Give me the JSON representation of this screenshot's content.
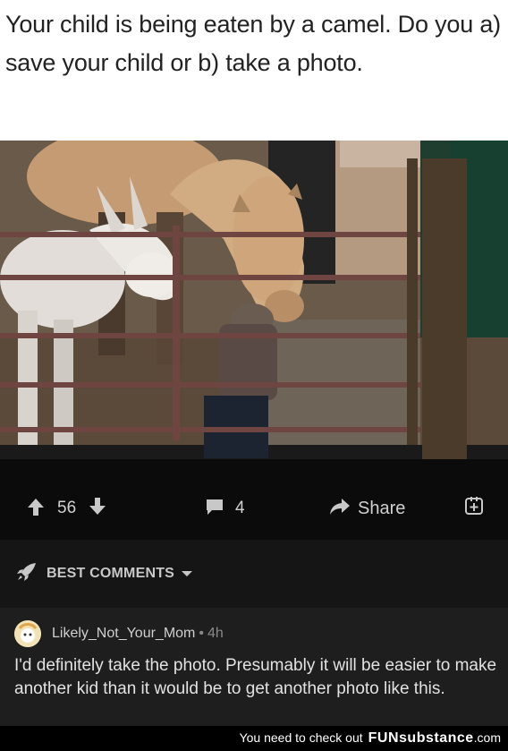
{
  "post": {
    "title": "Your child is being eaten by a camel. Do you a) save your child or b) take a photo."
  },
  "actions": {
    "upvote_icon": "arrow-up-icon",
    "votes": "56",
    "downvote_icon": "arrow-down-icon",
    "comment_icon": "comment-bubble-icon",
    "comments": "4",
    "share_icon": "share-arrow-icon",
    "share_label": "Share",
    "save_icon": "bookmark-add-icon"
  },
  "best_comments": {
    "icon": "rocket-icon",
    "label": "BEST COMMENTS",
    "dropdown_icon": "caret-down-icon"
  },
  "comment": {
    "username": "Likely_Not_Your_Mom",
    "separator": "•",
    "time": "4h",
    "text": "I'd definitely take the photo. Presumably it will be easier to make another kid than it would be to get another photo like this."
  },
  "footer": {
    "text": "You need to check out",
    "brand_fun": "FUN",
    "brand_sub": "substance",
    "brand_domain": ".com"
  },
  "colors": {
    "action_bar_bg": "#0b0b0b",
    "best_bar_bg": "#151515",
    "comment_bg": "#1e1e1e",
    "text_light": "#d0d0d0"
  }
}
